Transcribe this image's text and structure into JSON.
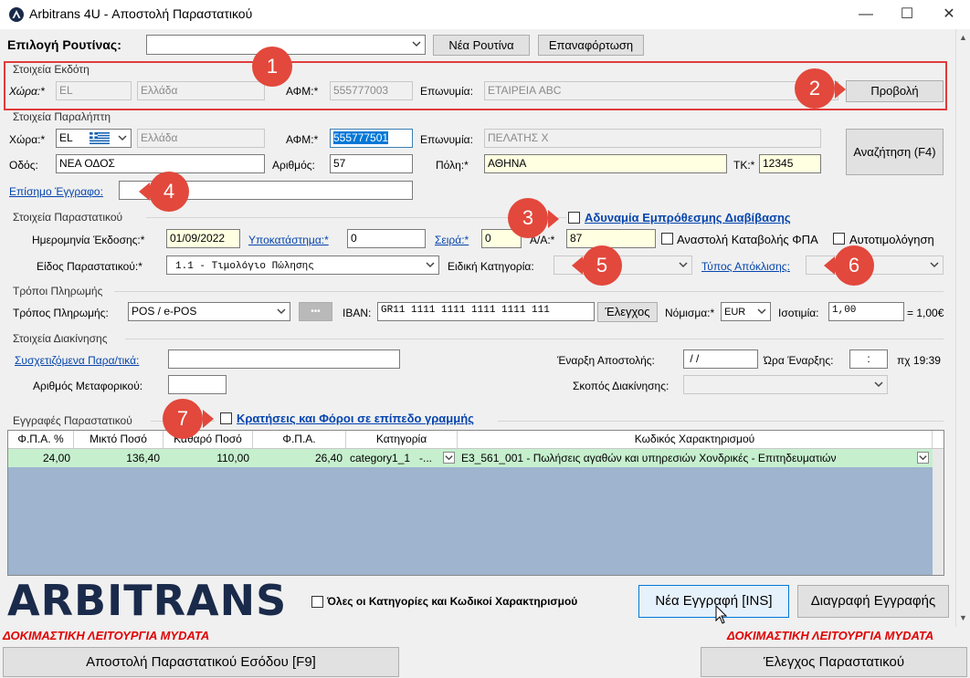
{
  "window": {
    "title": "Arbitrans 4U - Αποστολή Παραστατικού",
    "minimize": "—",
    "maximize": "☐",
    "close": "✕"
  },
  "routine": {
    "label": "Επιλογή Ρουτίνας:",
    "new_button": "Νέα Ρουτίνα",
    "reload_button": "Επαναφόρτωση"
  },
  "issuer": {
    "legend": "Στοιχεία Εκδότη",
    "country_label": "Χώρα:*",
    "country_code": "EL",
    "country_name": "Ελλάδα",
    "vat_label": "ΑΦΜ:*",
    "vat_value": "555777003",
    "name_label": "Επωνυμία:",
    "name_value": "ΕΤΑΙΡΕΙΑ ABC",
    "view_button": "Προβολή"
  },
  "recipient": {
    "legend": "Στοιχεία Παραλήπτη",
    "country_label": "Χώρα:*",
    "country_code": "EL",
    "country_name": "Ελλάδα",
    "vat_label": "ΑΦΜ:*",
    "vat_value": "555777501",
    "name_label": "Επωνυμία:",
    "name_value": "ΠΕΛΑΤΗΣ Χ",
    "street_label": "Οδός:",
    "street_value": "ΝΕΑ ΟΔΟΣ",
    "number_label": "Αριθμός:",
    "number_value": "57",
    "city_label": "Πόλη:*",
    "city_value": "ΑΘΗΝΑ",
    "zip_label": "ΤΚ:*",
    "zip_value": "12345",
    "official_doc_link": "Επίσημο Έγγραφο:",
    "official_doc_value": "",
    "search_button": "Αναζήτηση (F4)"
  },
  "document": {
    "legend": "Στοιχεία Παραστατικού",
    "future_issue_label": "Αδυναμία Εμπρόθεσμης Διαβίβασης",
    "date_label": "Ημερομηνία Έκδοσης:*",
    "date_value": "01/09/2022",
    "branch_link": "Υποκατάστημα:*",
    "branch_value": "0",
    "series_link": "Σειρά:*",
    "series_value": "0",
    "aa_label": "Α/Α:*",
    "aa_value": "87",
    "vat_suspension_label": "Αναστολή Καταβολής ΦΠΑ",
    "self_billing_label": "Αυτοτιμολόγηση",
    "type_label": "Είδος Παραστατικού:*",
    "type_value": "1.1 - Τιμολόγιο Πώλησης",
    "special_cat_label": "Ειδική Κατηγορία:",
    "special_cat_value": "",
    "deviation_link": "Τύπος Απόκλισης:",
    "deviation_value": ""
  },
  "payment": {
    "legend": "Τρόποι Πληρωμής",
    "method_label": "Τρόπος Πληρωμής:",
    "method_value": "POS / e-POS",
    "more_button": "•••",
    "iban_label": "IBAN:",
    "iban_value": "GR11 1111 1111 1111 1111 111",
    "check_button": "Έλεγχος",
    "currency_label": "Νόμισμα:*",
    "currency_value": "EUR",
    "rate_label": "Ισοτιμία:",
    "rate_value": "1,00",
    "rate_text": "= 1,00€"
  },
  "movement": {
    "legend": "Στοιχεία Διακίνησης",
    "related_link": "Συσχετιζόμενα Παρα/τικά:",
    "related_value": "",
    "start_label": "Έναρξη Αποστολής:",
    "start_value": " / /",
    "time_label": "Ώρα Έναρξης:",
    "time_value": ":",
    "time_hint": "πχ 19:39",
    "vehicle_label": "Αριθμός Μεταφορικού:",
    "vehicle_value": "",
    "purpose_label": "Σκοπός Διακίνησης:",
    "purpose_value": ""
  },
  "entries": {
    "legend": "Εγγραφές Παραστατικού",
    "line_taxes_label": "Κρατήσεις και Φόροι σε επίπεδο γραμμής",
    "columns": [
      "Φ.Π.Α. %",
      "Μικτό Ποσό",
      "Καθαρό Ποσό",
      "Φ.Π.Α.",
      "Κατηγορία",
      "Κωδικός Χαρακτηρισμού"
    ],
    "rows": [
      {
        "vat_pct": "24,00",
        "gross": "136,40",
        "net": "110,00",
        "vat": "26,40",
        "category": "category1_1",
        "category_suffix": "-...",
        "code": "E3_561_001 - Πωλήσεις αγαθών και υπηρεσιών Χονδρικές - Επιτηδευματιών"
      }
    ]
  },
  "footer": {
    "logo": "ARBITRANS",
    "all_categories_label": "Όλες οι Κατηγορίες και Κωδικοί Χαρακτηρισμού",
    "new_entry_button": "Νέα Εγγραφή [INS]",
    "delete_entry_button": "Διαγραφή Εγγραφής",
    "test_mode_left": "ΔΟΚΙΜΑΣΤΙΚΗ ΛΕΙΤΟΥΡΓΙΑ MYDATA",
    "test_mode_right": "ΔΟΚΙΜΑΣΤΙΚΗ ΛΕΙΤΟΥΡΓΙΑ MYDATA",
    "send_button": "Αποστολή Παραστατικού Εσόδου [F9]",
    "validate_button": "Έλεγχος Παραστατικού"
  },
  "callouts": [
    "1",
    "2",
    "3",
    "4",
    "5",
    "6",
    "7"
  ],
  "colors": {
    "callout": "#e2483c",
    "highlight_box": "#e23b3b",
    "grid_bg": "#9eb4cf",
    "row_bg": "#c6efce",
    "test_text": "#e00000",
    "link": "#0645ad",
    "logo": "#1a2a4a"
  }
}
